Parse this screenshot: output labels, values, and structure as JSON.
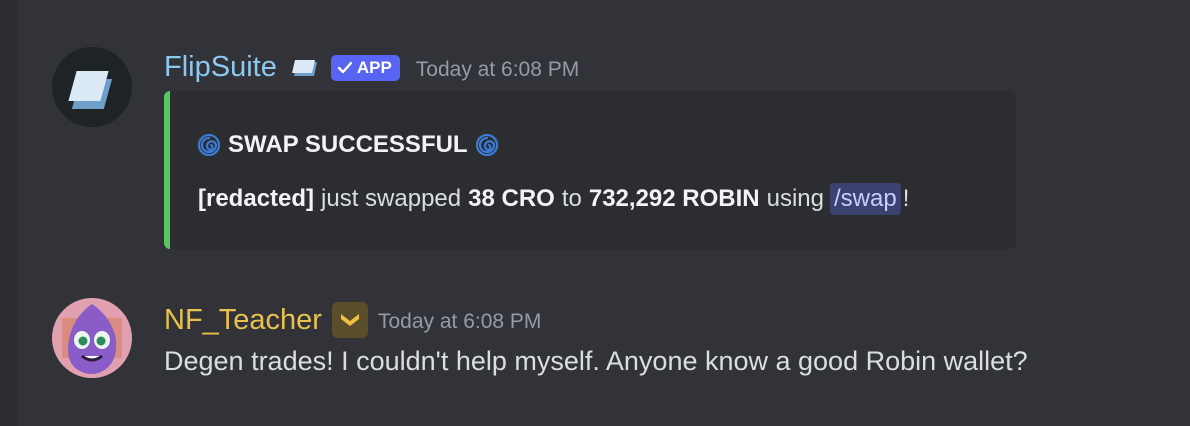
{
  "colors": {
    "background": "#313338",
    "embed_bg": "#2b2d31",
    "embed_accent": "#57c85a",
    "app_badge": "#5865f2",
    "flipsuite_name": "#8ec7f0",
    "nf_teacher_name": "#e9c24d",
    "timestamp": "#949ba4"
  },
  "messages": [
    {
      "author": "FlipSuite",
      "badge": "APP",
      "timestamp": "Today at 6:08 PM",
      "embed": {
        "title": "SWAP SUCCESSFUL",
        "title_icon": "cyclone-icon",
        "desc_user": "[redacted]",
        "desc_text1": "just swapped",
        "desc_amount_from": "38 CRO",
        "desc_text2": "to",
        "desc_amount_to": "732,292 ROBIN",
        "desc_text3": "using",
        "desc_command": "/swap",
        "desc_end": "!"
      }
    },
    {
      "author": "NF_Teacher",
      "timestamp": "Today at 6:08 PM",
      "content": "Degen trades! I couldn't help myself. Anyone know a good Robin wallet?"
    }
  ]
}
